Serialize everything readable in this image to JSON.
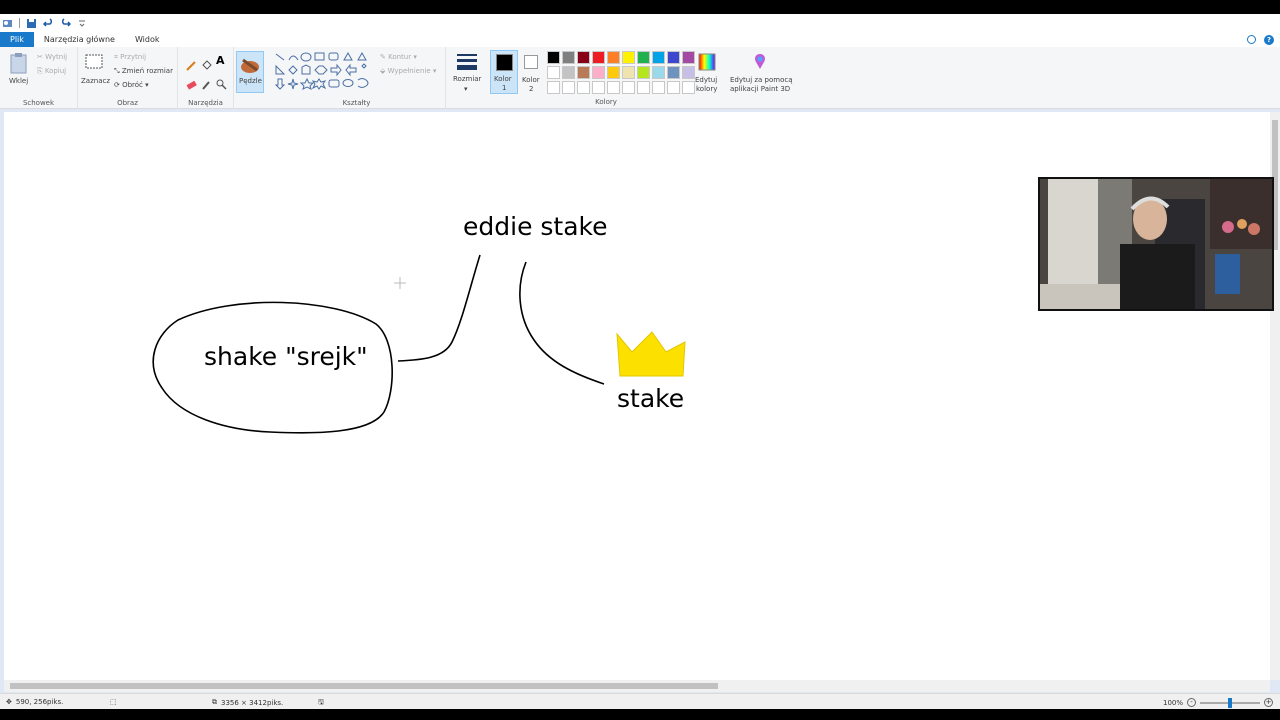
{
  "tabs": [
    {
      "label": "Plik"
    },
    {
      "label": "Narzędzia główne"
    },
    {
      "label": "Widok"
    }
  ],
  "ribbon": {
    "clipboard": {
      "paste": "Wklej",
      "cut": "Wytnij",
      "copy": "Kopiuj",
      "group": "Schowek"
    },
    "image": {
      "select": "Zaznacz",
      "crop": "Przytnij",
      "resize": "Zmień rozmiar",
      "rotate": "Obróć",
      "group": "Obraz"
    },
    "tools": {
      "group": "Narzędzia"
    },
    "brushes": {
      "label": "Pędzle"
    },
    "shapes": {
      "outline": "Kontur",
      "fill": "Wypełnienie",
      "group": "Kształty"
    },
    "size": {
      "label": "Rozmiar"
    },
    "color1": {
      "label": "Kolor",
      "num": "1"
    },
    "color2": {
      "label": "Kolor",
      "num": "2"
    },
    "colors_group": "Kolory",
    "edit_colors": {
      "line1": "Edytuj",
      "line2": "kolory"
    },
    "paint3d": {
      "line1": "Edytuj za pomocą",
      "line2": "aplikacji Paint 3D"
    },
    "palette": [
      "#000000",
      "#7f7f7f",
      "#880015",
      "#ed1c24",
      "#ff7f27",
      "#fff200",
      "#22b14c",
      "#00a2e8",
      "#3f48cc",
      "#a349a4",
      "#ffffff",
      "#c3c3c3",
      "#b97a57",
      "#ffaec9",
      "#ffc90e",
      "#efe4b0",
      "#b5e61d",
      "#99d9ea",
      "#7092be",
      "#c8bfe7",
      "#ffffff",
      "#ffffff",
      "#ffffff",
      "#ffffff",
      "#ffffff",
      "#ffffff",
      "#ffffff",
      "#ffffff",
      "#ffffff",
      "#ffffff"
    ]
  },
  "canvas": {
    "texts": {
      "top": "eddie stake",
      "left": "shake \"srejk\"",
      "right": "stake"
    },
    "crown_color": "#fce100"
  },
  "status": {
    "cursor_pos": "590, 256piks.",
    "image_size": "3356 × 3412piks.",
    "zoom": "100%"
  }
}
